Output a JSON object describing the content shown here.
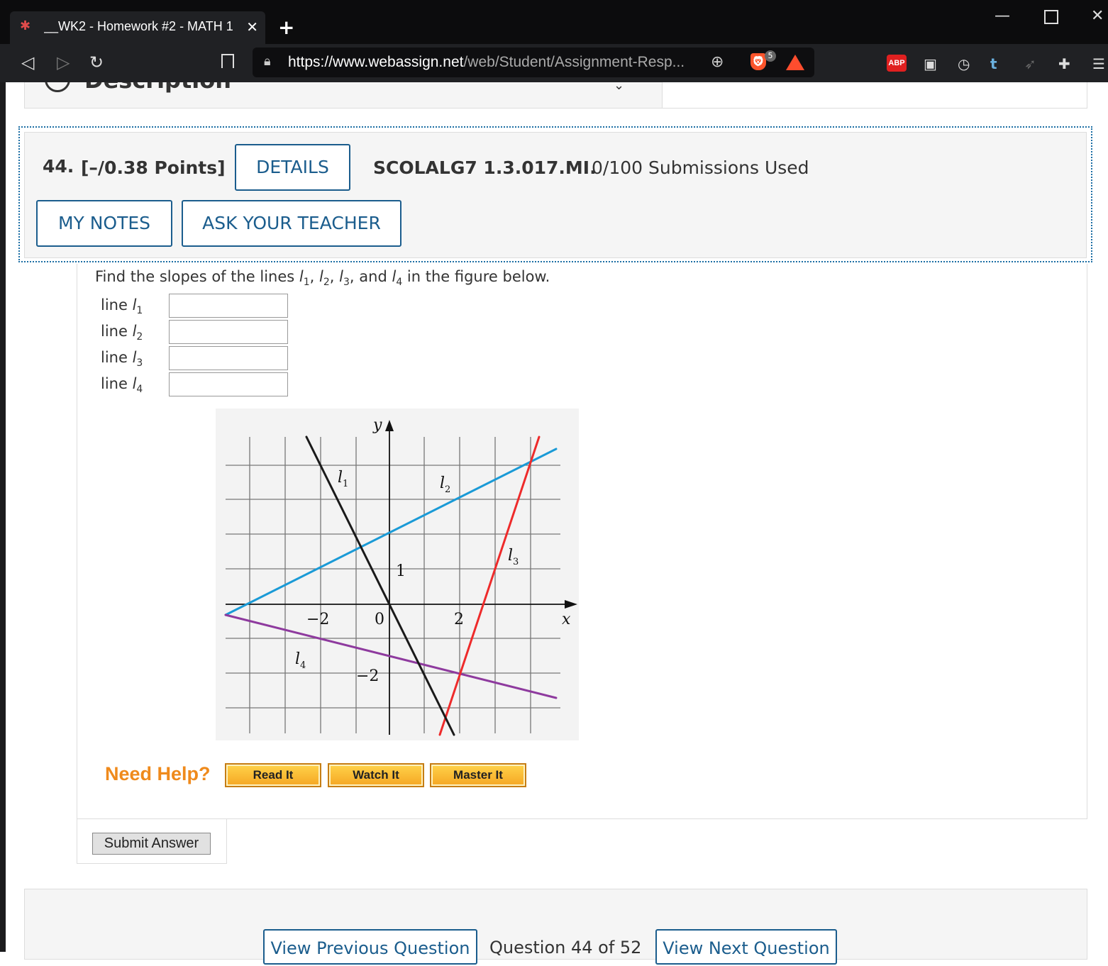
{
  "browser": {
    "tab_title": "__WK2 - Homework #2 - MATH 1",
    "tab_close": "✕",
    "new_tab": "+",
    "url_host": "https://www.webassign.net",
    "url_path": "/web/Student/Assignment-Resp...",
    "brave_badge_count": "5",
    "abp_label": "ABP"
  },
  "description": {
    "title": "Description"
  },
  "question": {
    "number": "44.",
    "points": "[–/0.38 Points]",
    "details_label": "DETAILS",
    "code": "SCOLALG7 1.3.017.MI.",
    "submissions": "0/100 Submissions Used",
    "my_notes_label": "MY NOTES",
    "ask_teacher_label": "ASK YOUR TEACHER",
    "prompt_start": "Find the slopes of the lines ",
    "prompt_end": " in the figure below.",
    "answer_rows": [
      {
        "label": "line ",
        "sub": "1",
        "value": ""
      },
      {
        "label": "line ",
        "sub": "2",
        "value": ""
      },
      {
        "label": "line ",
        "sub": "3",
        "value": ""
      },
      {
        "label": "line ",
        "sub": "4",
        "value": ""
      }
    ]
  },
  "figure": {
    "tick_labels": {
      "x_neg2": "−2",
      "origin": "0",
      "x_2": "2",
      "y_1": "1",
      "y_neg2": "−2"
    },
    "axis_x": "x",
    "axis_y": "y",
    "lines": [
      {
        "name": "l",
        "sub": "1",
        "color": "#1a1a1a"
      },
      {
        "name": "l",
        "sub": "2",
        "color": "#1a9ad6"
      },
      {
        "name": "l",
        "sub": "3",
        "color": "#ee2b2b"
      },
      {
        "name": "l",
        "sub": "4",
        "color": "#8e3a9e"
      }
    ]
  },
  "help": {
    "title": "Need Help?",
    "read_it": "Read It",
    "watch_it": "Watch It",
    "master_it": "Master It"
  },
  "submit_label": "Submit Answer",
  "navigation": {
    "prev_label": "View Previous Question",
    "position": "Question 44 of 52",
    "next_label": "View Next Question"
  }
}
